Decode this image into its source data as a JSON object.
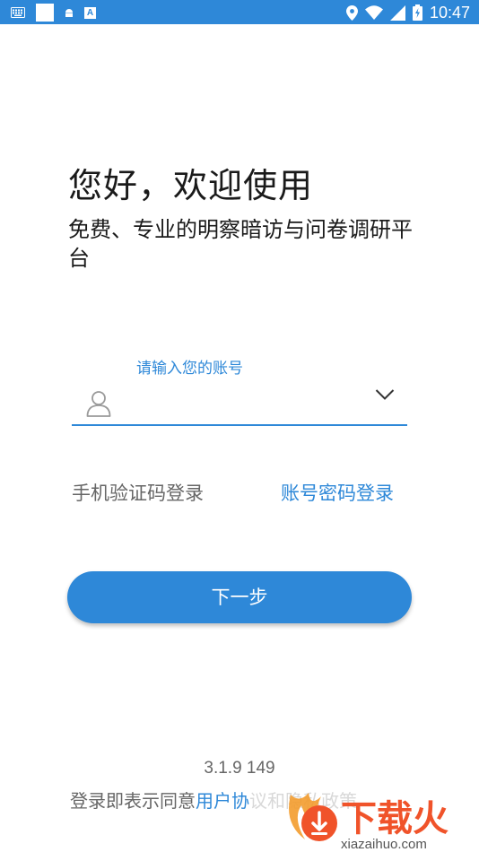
{
  "status_bar": {
    "time": "10:47",
    "notification_icons": [
      "keyboard-icon",
      "square-icon",
      "android-icon",
      "a-icon"
    ],
    "system_icons": [
      "location-icon",
      "wifi-icon",
      "signal-icon",
      "battery-icon"
    ],
    "a_icon_text": "A",
    "color": "#2e88d8"
  },
  "header": {
    "greeting": "您好，欢迎使用",
    "subtitle": "免费、专业的明察暗访与问卷调研平台"
  },
  "account_field": {
    "label": "请输入您的账号",
    "value": "",
    "placeholder": ""
  },
  "login_options": {
    "sms": "手机验证码登录",
    "password": "账号密码登录"
  },
  "actions": {
    "next": "下一步"
  },
  "footer": {
    "version": "3.1.9 149",
    "agreement_prefix": "登录即表示同意",
    "agreement_link": "用户协",
    "agreement_rest": "议和隐私政策"
  },
  "watermark": {
    "text": "下载火",
    "url": "xiazaihuo.com"
  },
  "colors": {
    "accent": "#2e88d8",
    "text_dark": "#1a1a1a",
    "text_gray": "#666666"
  }
}
